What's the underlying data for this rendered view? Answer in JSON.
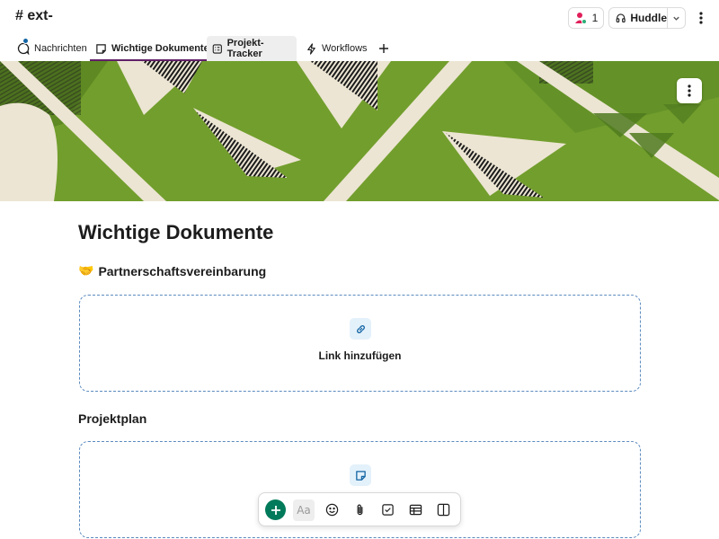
{
  "header": {
    "channel_title": "# ext-",
    "member_count": "1",
    "huddle_label": "Huddle"
  },
  "tabs": [
    {
      "label": "Nachrichten",
      "icon": "message-icon"
    },
    {
      "label": "Wichtige Dokumente",
      "icon": "canvas-icon",
      "active": true
    },
    {
      "label": "Projekt-Tracker",
      "icon": "list-icon"
    },
    {
      "label": "Workflows",
      "icon": "lightning-icon"
    }
  ],
  "document": {
    "title": "Wichtige Dokumente",
    "sections": [
      {
        "emoji": "🤝",
        "title": "Partnerschaftsvereinbarung",
        "card_label": "Link hinzufügen",
        "card_icon": "link-icon"
      },
      {
        "title": "Projektplan",
        "card_icon": "note-icon"
      }
    ]
  },
  "toolbar": {
    "format_label": "Aa",
    "buttons": [
      "add-icon",
      "text-format-icon",
      "emoji-icon",
      "attachment-icon",
      "checkbox-icon",
      "table-icon",
      "columns-icon"
    ]
  },
  "colors": {
    "accent_purple": "#611f69",
    "add_green": "#007a5a",
    "banner_green": "#6e9a2c",
    "paper_cream": "#ece5d3",
    "dashed_border": "#5b8bbf"
  }
}
